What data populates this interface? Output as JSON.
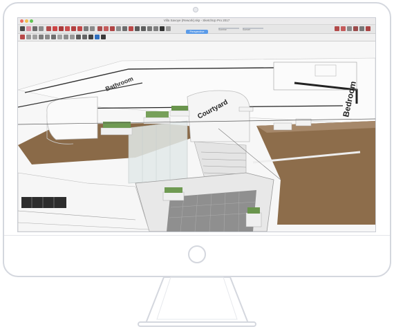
{
  "window": {
    "title": "Villa Savoye (Rework).skp - SketchUp Pro 2017"
  },
  "toolbar": {
    "scene_tab_label": "Perspective",
    "slider_left_label": "Sunrise",
    "slider_right_label": "Sunset"
  },
  "model": {
    "labels": {
      "room_1": "Bathroom",
      "room_2": "Courtyard",
      "room_3": "Bedroom"
    }
  },
  "colors": {
    "window_close": "#ec6a5e",
    "window_minimize": "#f4bf4f",
    "window_zoom": "#61c554",
    "roof_terrace": "#8a6a48",
    "walls": "#f5f5f5",
    "glass": "#dfe7e8",
    "planters": "#6f9a52"
  },
  "icons": [
    "select-icon",
    "eraser-icon",
    "pencil-icon",
    "line-icon",
    "arc-icon",
    "rectangle-icon",
    "push-pull-icon",
    "move-icon",
    "rotate-icon",
    "scale-icon",
    "offset-icon",
    "tape-icon",
    "text-icon",
    "paint-icon",
    "orbit-icon",
    "pan-icon",
    "zoom-icon",
    "zoom-extents-icon",
    "section-icon",
    "camera-icon",
    "walk-icon",
    "look-icon",
    "shadow-icon",
    "fog-icon",
    "settings-icon"
  ]
}
